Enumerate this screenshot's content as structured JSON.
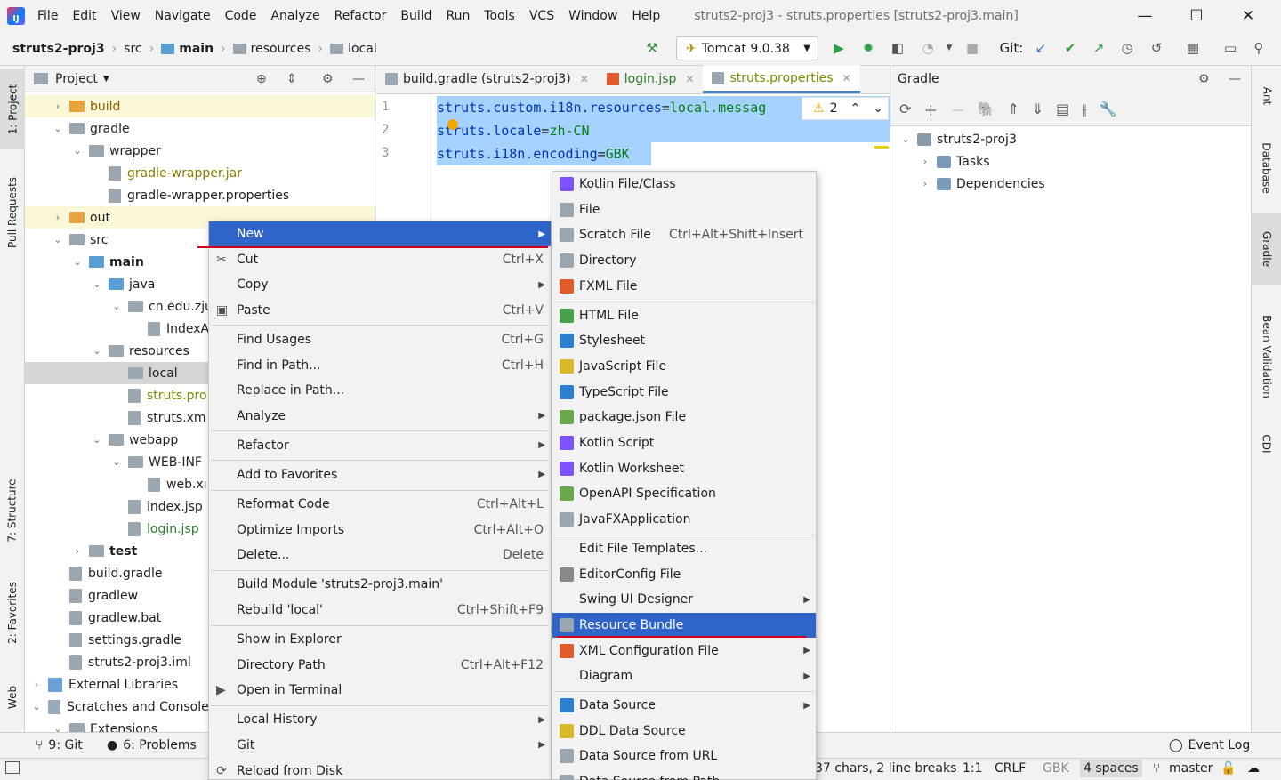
{
  "window": {
    "title": "struts2-proj3 - struts.properties [struts2-proj3.main]",
    "logo": "IJ",
    "menu": [
      "File",
      "Edit",
      "View",
      "Navigate",
      "Code",
      "Analyze",
      "Refactor",
      "Build",
      "Run",
      "Tools",
      "VCS",
      "Window",
      "Help"
    ],
    "controls": {
      "minimize": "—",
      "maximize": "☐",
      "close": "✕"
    }
  },
  "breadcrumb": [
    "struts2-proj3",
    "src",
    "main",
    "resources",
    "local"
  ],
  "toolbar": {
    "run_config": "Tomcat 9.0.38",
    "git_label": "Git:"
  },
  "left_strip": [
    "1: Project",
    "Pull Requests",
    "7: Structure",
    "2: Favorites",
    "Web"
  ],
  "right_strip": [
    "Ant",
    "Database",
    "Gradle",
    "Bean Validation",
    "CDI"
  ],
  "project_panel": {
    "title": "Project",
    "rows": [
      {
        "label": "build",
        "indent": 0,
        "chev": "›",
        "icon": "folder-orange",
        "color": "#8a5a00"
      },
      {
        "label": "gradle",
        "indent": 0,
        "chev": "⌄",
        "icon": "folder",
        "color": "#1e1e1e"
      },
      {
        "label": "wrapper",
        "indent": 1,
        "chev": "⌄",
        "icon": "folder",
        "color": "#1e1e1e"
      },
      {
        "label": "gradle-wrapper.jar",
        "indent": 2,
        "chev": "",
        "icon": "file",
        "color": "#8a7a00"
      },
      {
        "label": "gradle-wrapper.properties",
        "indent": 2,
        "chev": "",
        "icon": "file",
        "color": "#1e1e1e"
      },
      {
        "label": "out",
        "indent": 0,
        "chev": "›",
        "icon": "folder-orange",
        "color": "#1e1e1e"
      },
      {
        "label": "src",
        "indent": 0,
        "chev": "⌄",
        "icon": "folder",
        "color": "#1e1e1e"
      },
      {
        "label": "main",
        "indent": 1,
        "chev": "⌄",
        "icon": "folder-blue",
        "color": "#1e1e1e"
      },
      {
        "label": "java",
        "indent": 2,
        "chev": "⌄",
        "icon": "folder-blue",
        "color": "#1e1e1e"
      },
      {
        "label": "cn.edu.zju",
        "indent": 3,
        "chev": "⌄",
        "icon": "folder",
        "color": "#1e1e1e"
      },
      {
        "label": "IndexA",
        "indent": 4,
        "chev": "",
        "icon": "file",
        "color": "#1e1e1e"
      },
      {
        "label": "resources",
        "indent": 2,
        "chev": "⌄",
        "icon": "folder",
        "color": "#1e1e1e"
      },
      {
        "label": "local",
        "indent": 3,
        "chev": "",
        "icon": "folder",
        "color": "#1e1e1e"
      },
      {
        "label": "struts.pro",
        "indent": 3,
        "chev": "",
        "icon": "file",
        "color": "#7a8a00"
      },
      {
        "label": "struts.xm",
        "indent": 3,
        "chev": "",
        "icon": "file",
        "color": "#1e1e1e"
      },
      {
        "label": "webapp",
        "indent": 2,
        "chev": "⌄",
        "icon": "folder",
        "color": "#1e1e1e"
      },
      {
        "label": "WEB-INF",
        "indent": 3,
        "chev": "⌄",
        "icon": "folder",
        "color": "#1e1e1e"
      },
      {
        "label": "web.xı",
        "indent": 4,
        "chev": "",
        "icon": "file",
        "color": "#1e1e1e"
      },
      {
        "label": "index.jsp",
        "indent": 3,
        "chev": "",
        "icon": "file",
        "color": "#1e1e1e"
      },
      {
        "label": "login.jsp",
        "indent": 3,
        "chev": "",
        "icon": "file",
        "color": "#2a7a2a"
      },
      {
        "label": "test",
        "indent": 1,
        "chev": "›",
        "icon": "folder",
        "color": "#1e1e1e"
      },
      {
        "label": "build.gradle",
        "indent": 0,
        "chev": "",
        "icon": "file",
        "color": "#1e1e1e"
      },
      {
        "label": "gradlew",
        "indent": 0,
        "chev": "",
        "icon": "file",
        "color": "#1e1e1e"
      },
      {
        "label": "gradlew.bat",
        "indent": 0,
        "chev": "",
        "icon": "file",
        "color": "#1e1e1e"
      },
      {
        "label": "settings.gradle",
        "indent": 0,
        "chev": "",
        "icon": "file",
        "color": "#1e1e1e"
      },
      {
        "label": "struts2-proj3.iml",
        "indent": 0,
        "chev": "",
        "icon": "file",
        "color": "#1e1e1e"
      },
      {
        "label": "External Libraries",
        "indent": -1,
        "chev": "›",
        "icon": "lib",
        "color": "#1e1e1e"
      },
      {
        "label": "Scratches and Console",
        "indent": -1,
        "chev": "⌄",
        "icon": "scratch",
        "color": "#1e1e1e"
      },
      {
        "label": "Extensions",
        "indent": 0,
        "chev": "⌄",
        "icon": "folder",
        "color": "#1e1e1e"
      }
    ]
  },
  "editor": {
    "tabs": [
      {
        "label": "build.gradle (struts2-proj3)",
        "color": "#1e1e1e"
      },
      {
        "label": "login.jsp",
        "color": "#2a7a2a"
      },
      {
        "label": "struts.properties",
        "color": "#7a8a00"
      }
    ],
    "lines": [
      {
        "num": "1",
        "key": "struts.custom.i18n.resources",
        "eq": "=",
        "val": "local.messag"
      },
      {
        "num": "2",
        "key": "struts.locale",
        "eq": "=",
        "val": "zh-CN"
      },
      {
        "num": "3",
        "key": "struts.i18n.encoding",
        "eq": "=",
        "val": "GBK"
      }
    ],
    "warning_count": "2"
  },
  "gradle_panel": {
    "title": "Gradle",
    "tree": [
      {
        "label": "struts2-proj3",
        "chev": "⌄"
      },
      {
        "label": "Tasks",
        "chev": "›"
      },
      {
        "label": "Dependencies",
        "chev": "›"
      }
    ]
  },
  "context_menu": [
    {
      "label": "New",
      "shortcut": "",
      "submenu": true,
      "selected": true,
      "sep_after": false,
      "icon": ""
    },
    {
      "label": "Cut",
      "shortcut": "Ctrl+X",
      "submenu": false,
      "icon": "scissors-icon"
    },
    {
      "label": "Copy",
      "shortcut": "",
      "submenu": true,
      "icon": ""
    },
    {
      "label": "Paste",
      "shortcut": "Ctrl+V",
      "submenu": false,
      "icon": "paste-icon",
      "sep_after": true
    },
    {
      "label": "Find Usages",
      "shortcut": "Ctrl+G",
      "submenu": false
    },
    {
      "label": "Find in Path...",
      "shortcut": "Ctrl+H",
      "submenu": false
    },
    {
      "label": "Replace in Path...",
      "shortcut": "",
      "submenu": false
    },
    {
      "label": "Analyze",
      "shortcut": "",
      "submenu": true,
      "sep_after": true
    },
    {
      "label": "Refactor",
      "shortcut": "",
      "submenu": true,
      "sep_after": true
    },
    {
      "label": "Add to Favorites",
      "shortcut": "",
      "submenu": true,
      "sep_after": true
    },
    {
      "label": "Reformat Code",
      "shortcut": "Ctrl+Alt+L",
      "submenu": false
    },
    {
      "label": "Optimize Imports",
      "shortcut": "Ctrl+Alt+O",
      "submenu": false
    },
    {
      "label": "Delete...",
      "shortcut": "Delete",
      "submenu": false,
      "sep_after": true
    },
    {
      "label": "Build Module 'struts2-proj3.main'",
      "shortcut": "",
      "submenu": false
    },
    {
      "label": "Rebuild 'local'",
      "shortcut": "Ctrl+Shift+F9",
      "submenu": false,
      "sep_after": true
    },
    {
      "label": "Show in Explorer",
      "shortcut": "",
      "submenu": false
    },
    {
      "label": "Directory Path",
      "shortcut": "Ctrl+Alt+F12",
      "submenu": false
    },
    {
      "label": "Open in Terminal",
      "shortcut": "",
      "submenu": false,
      "icon": "terminal-icon",
      "sep_after": true
    },
    {
      "label": "Local History",
      "shortcut": "",
      "submenu": true
    },
    {
      "label": "Git",
      "shortcut": "",
      "submenu": true
    },
    {
      "label": "Reload from Disk",
      "shortcut": "",
      "submenu": false,
      "icon": "reload-icon"
    }
  ],
  "new_submenu": [
    {
      "label": "Kotlin File/Class",
      "shortcut": "",
      "submenu": false,
      "icon_color": "#7f52ff"
    },
    {
      "label": "File",
      "shortcut": "",
      "submenu": false,
      "icon_color": "#9aa7b0"
    },
    {
      "label": "Scratch File",
      "shortcut": "Ctrl+Alt+Shift+Insert",
      "submenu": false,
      "icon_color": "#9aa7b0"
    },
    {
      "label": "Directory",
      "shortcut": "",
      "submenu": false,
      "icon_color": "#9aa7b0"
    },
    {
      "label": "FXML File",
      "shortcut": "",
      "submenu": false,
      "icon_color": "#e05a2b",
      "sep_after": true
    },
    {
      "label": "HTML File",
      "shortcut": "",
      "submenu": false,
      "icon_color": "#4a9f4a"
    },
    {
      "label": "Stylesheet",
      "shortcut": "",
      "submenu": false,
      "icon_color": "#2f7fd0"
    },
    {
      "label": "JavaScript File",
      "shortcut": "",
      "submenu": false,
      "icon_color": "#d9b92a"
    },
    {
      "label": "TypeScript File",
      "shortcut": "",
      "submenu": false,
      "icon_color": "#2f7fd0"
    },
    {
      "label": "package.json File",
      "shortcut": "",
      "submenu": false,
      "icon_color": "#6aa84f"
    },
    {
      "label": "Kotlin Script",
      "shortcut": "",
      "submenu": false,
      "icon_color": "#7f52ff"
    },
    {
      "label": "Kotlin Worksheet",
      "shortcut": "",
      "submenu": false,
      "icon_color": "#7f52ff"
    },
    {
      "label": "OpenAPI Specification",
      "shortcut": "",
      "submenu": false,
      "icon_color": "#6aa84f"
    },
    {
      "label": "JavaFXApplication",
      "shortcut": "",
      "submenu": false,
      "icon_color": "#9aa7b0",
      "sep_after": true
    },
    {
      "label": "Edit File Templates...",
      "shortcut": "",
      "submenu": false,
      "icon_color": ""
    },
    {
      "label": "EditorConfig File",
      "shortcut": "",
      "submenu": false,
      "icon_color": "#888888"
    },
    {
      "label": "Swing UI Designer",
      "shortcut": "",
      "submenu": true,
      "icon_color": ""
    },
    {
      "label": "Resource Bundle",
      "shortcut": "",
      "submenu": false,
      "icon_color": "#9aa7b0",
      "selected": true
    },
    {
      "label": "XML Configuration File",
      "shortcut": "",
      "submenu": true,
      "icon_color": "#e05a2b"
    },
    {
      "label": "Diagram",
      "shortcut": "",
      "submenu": true,
      "icon_color": "",
      "sep_after": true
    },
    {
      "label": "Data Source",
      "shortcut": "",
      "submenu": true,
      "icon_color": "#2f7fd0"
    },
    {
      "label": "DDL Data Source",
      "shortcut": "",
      "submenu": false,
      "icon_color": "#d9b92a"
    },
    {
      "label": "Data Source from URL",
      "shortcut": "",
      "submenu": false,
      "icon_color": "#9aa7b0"
    },
    {
      "label": "Data Source from Path",
      "shortcut": "",
      "submenu": false,
      "icon_color": "#9aa7b0"
    }
  ],
  "status": {
    "git_tab": "9: Git",
    "problems_tab": "6: Problems",
    "event_log": "Event Log",
    "info": "37 chars, 2 line breaks",
    "position": "1:1",
    "line_sep": "CRLF",
    "encoding": "GBK",
    "indent": "4 spaces",
    "branch": "master"
  }
}
